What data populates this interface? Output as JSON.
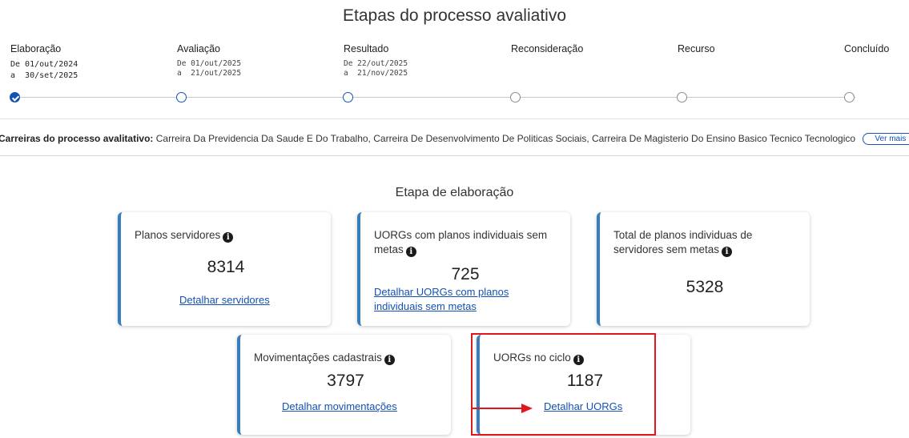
{
  "header": {
    "title": "Etapas do processo avaliativo"
  },
  "timeline": {
    "steps": [
      {
        "label": "Elaboração",
        "dates": "De 01/out/2024\na  30/set/2025",
        "status": "done"
      },
      {
        "label": "Avaliação",
        "dates": "De 01/out/2025\na  21/out/2025",
        "status": "pending"
      },
      {
        "label": "Resultado",
        "dates": "De 22/out/2025\na  21/nov/2025",
        "status": "pending"
      },
      {
        "label": "Reconsideração",
        "dates": "",
        "status": "pending"
      },
      {
        "label": "Recurso",
        "dates": "",
        "status": "pending"
      },
      {
        "label": "Concluído",
        "dates": "",
        "status": "pending"
      }
    ]
  },
  "careers": {
    "label": "Carreiras do processo avalitativo:",
    "text": " Carreira Da Previdencia Da Saude E Do Trabalho, Carreira De Desenvolvimento De Politicas Sociais, Carreira De Magisterio Do Ensino Basico Tecnico Tecnologico",
    "more_button": "Ver mais"
  },
  "section": {
    "title": "Etapa de elaboração"
  },
  "cards": {
    "planos": {
      "title": "Planos servidores",
      "value": "8314",
      "link": "Detalhar servidores"
    },
    "uorgs_sem_metas": {
      "title": "UORGs com planos individuais sem metas",
      "value": "725",
      "link": "Detalhar UORGs com planos individuais sem metas"
    },
    "total_sem_metas": {
      "title": "Total de planos individuas de servidores sem metas",
      "value": "5328"
    },
    "movimentacoes": {
      "title": "Movimentações cadastrais",
      "value": "3797",
      "link": "Detalhar movimentações"
    },
    "uorgs_ciclo": {
      "title": "UORGs no ciclo",
      "value": "1187",
      "link": "Detalhar UORGs"
    }
  },
  "icons": {
    "info": "info-icon",
    "check": "check-icon"
  },
  "colors": {
    "primary": "#1351b4",
    "card_accent": "#3a7dbc",
    "highlight": "#e2171e"
  }
}
